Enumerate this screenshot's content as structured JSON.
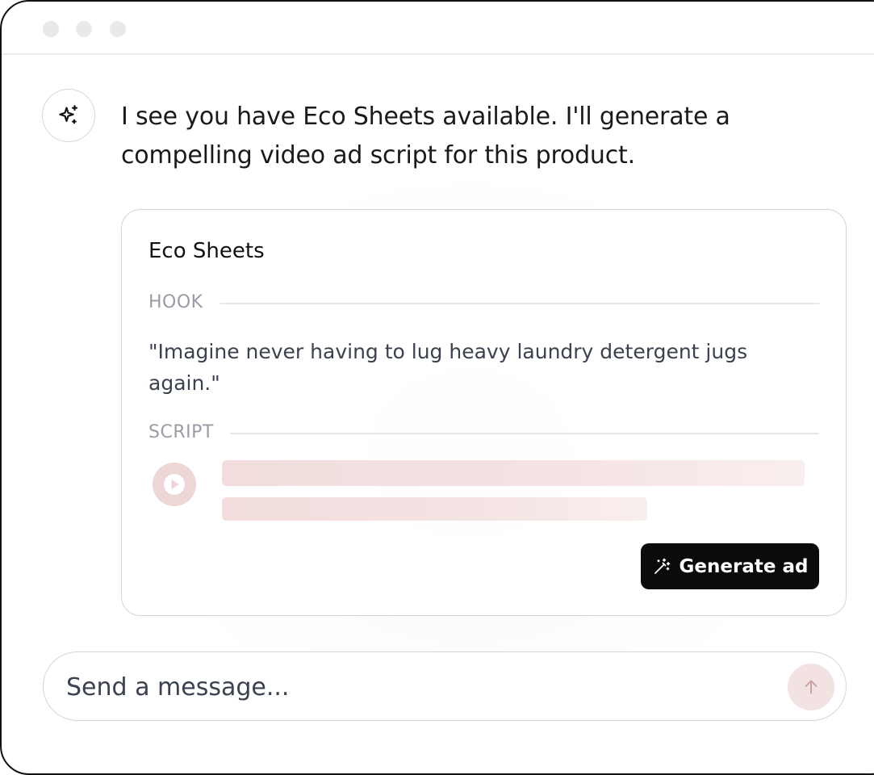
{
  "window": {
    "traffic_lights": [
      "close",
      "minimize",
      "maximize"
    ]
  },
  "assistant": {
    "avatar_icon": "sparkles-icon",
    "message_line1": "I see you have Eco Sheets available. I'll generate a",
    "message_line2": "compelling video ad script for this product."
  },
  "card": {
    "product_name": "Eco Sheets",
    "hook_label": "HOOK",
    "hook_text": "\"Imagine never having to lug heavy laundry detergent jugs again.\"",
    "script_label": "SCRIPT",
    "play_icon": "play-icon",
    "generate_label": "Generate ad",
    "generate_icon": "magic-wand-icon"
  },
  "composer": {
    "placeholder": "Send a message...",
    "send_icon": "arrow-up-icon"
  },
  "colors": {
    "primary_button": "#0b0b0b",
    "skeleton": "#f2dcdc",
    "play_button": "#ecd6d6",
    "send_button": "#f3e2e2"
  }
}
